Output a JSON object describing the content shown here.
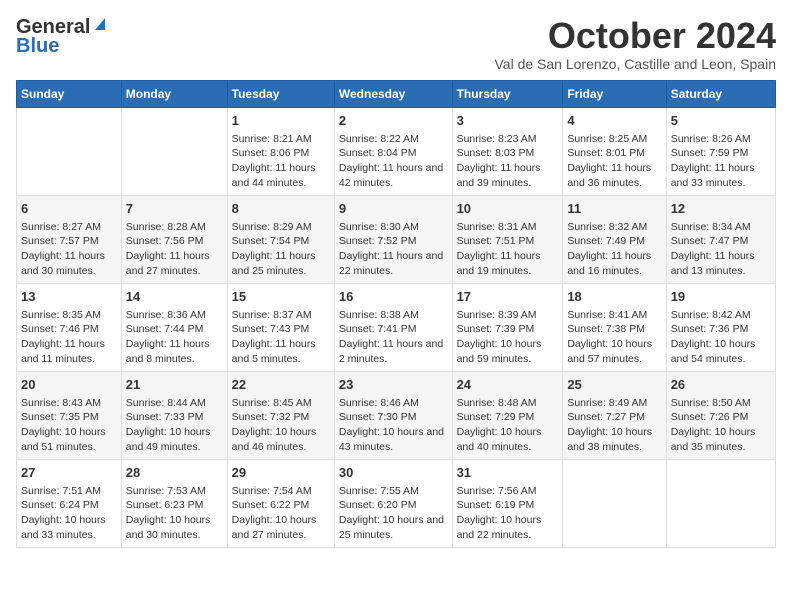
{
  "logo": {
    "line1": "General",
    "line2": "Blue"
  },
  "title": "October 2024",
  "subtitle": "Val de San Lorenzo, Castille and Leon, Spain",
  "weekdays": [
    "Sunday",
    "Monday",
    "Tuesday",
    "Wednesday",
    "Thursday",
    "Friday",
    "Saturday"
  ],
  "weeks": [
    [
      {
        "day": "",
        "info": ""
      },
      {
        "day": "",
        "info": ""
      },
      {
        "day": "1",
        "info": "Sunrise: 8:21 AM\nSunset: 8:06 PM\nDaylight: 11 hours and 44 minutes."
      },
      {
        "day": "2",
        "info": "Sunrise: 8:22 AM\nSunset: 8:04 PM\nDaylight: 11 hours and 42 minutes."
      },
      {
        "day": "3",
        "info": "Sunrise: 8:23 AM\nSunset: 8:03 PM\nDaylight: 11 hours and 39 minutes."
      },
      {
        "day": "4",
        "info": "Sunrise: 8:25 AM\nSunset: 8:01 PM\nDaylight: 11 hours and 36 minutes."
      },
      {
        "day": "5",
        "info": "Sunrise: 8:26 AM\nSunset: 7:59 PM\nDaylight: 11 hours and 33 minutes."
      }
    ],
    [
      {
        "day": "6",
        "info": "Sunrise: 8:27 AM\nSunset: 7:57 PM\nDaylight: 11 hours and 30 minutes."
      },
      {
        "day": "7",
        "info": "Sunrise: 8:28 AM\nSunset: 7:56 PM\nDaylight: 11 hours and 27 minutes."
      },
      {
        "day": "8",
        "info": "Sunrise: 8:29 AM\nSunset: 7:54 PM\nDaylight: 11 hours and 25 minutes."
      },
      {
        "day": "9",
        "info": "Sunrise: 8:30 AM\nSunset: 7:52 PM\nDaylight: 11 hours and 22 minutes."
      },
      {
        "day": "10",
        "info": "Sunrise: 8:31 AM\nSunset: 7:51 PM\nDaylight: 11 hours and 19 minutes."
      },
      {
        "day": "11",
        "info": "Sunrise: 8:32 AM\nSunset: 7:49 PM\nDaylight: 11 hours and 16 minutes."
      },
      {
        "day": "12",
        "info": "Sunrise: 8:34 AM\nSunset: 7:47 PM\nDaylight: 11 hours and 13 minutes."
      }
    ],
    [
      {
        "day": "13",
        "info": "Sunrise: 8:35 AM\nSunset: 7:46 PM\nDaylight: 11 hours and 11 minutes."
      },
      {
        "day": "14",
        "info": "Sunrise: 8:36 AM\nSunset: 7:44 PM\nDaylight: 11 hours and 8 minutes."
      },
      {
        "day": "15",
        "info": "Sunrise: 8:37 AM\nSunset: 7:43 PM\nDaylight: 11 hours and 5 minutes."
      },
      {
        "day": "16",
        "info": "Sunrise: 8:38 AM\nSunset: 7:41 PM\nDaylight: 11 hours and 2 minutes."
      },
      {
        "day": "17",
        "info": "Sunrise: 8:39 AM\nSunset: 7:39 PM\nDaylight: 10 hours and 59 minutes."
      },
      {
        "day": "18",
        "info": "Sunrise: 8:41 AM\nSunset: 7:38 PM\nDaylight: 10 hours and 57 minutes."
      },
      {
        "day": "19",
        "info": "Sunrise: 8:42 AM\nSunset: 7:36 PM\nDaylight: 10 hours and 54 minutes."
      }
    ],
    [
      {
        "day": "20",
        "info": "Sunrise: 8:43 AM\nSunset: 7:35 PM\nDaylight: 10 hours and 51 minutes."
      },
      {
        "day": "21",
        "info": "Sunrise: 8:44 AM\nSunset: 7:33 PM\nDaylight: 10 hours and 49 minutes."
      },
      {
        "day": "22",
        "info": "Sunrise: 8:45 AM\nSunset: 7:32 PM\nDaylight: 10 hours and 46 minutes."
      },
      {
        "day": "23",
        "info": "Sunrise: 8:46 AM\nSunset: 7:30 PM\nDaylight: 10 hours and 43 minutes."
      },
      {
        "day": "24",
        "info": "Sunrise: 8:48 AM\nSunset: 7:29 PM\nDaylight: 10 hours and 40 minutes."
      },
      {
        "day": "25",
        "info": "Sunrise: 8:49 AM\nSunset: 7:27 PM\nDaylight: 10 hours and 38 minutes."
      },
      {
        "day": "26",
        "info": "Sunrise: 8:50 AM\nSunset: 7:26 PM\nDaylight: 10 hours and 35 minutes."
      }
    ],
    [
      {
        "day": "27",
        "info": "Sunrise: 7:51 AM\nSunset: 6:24 PM\nDaylight: 10 hours and 33 minutes."
      },
      {
        "day": "28",
        "info": "Sunrise: 7:53 AM\nSunset: 6:23 PM\nDaylight: 10 hours and 30 minutes."
      },
      {
        "day": "29",
        "info": "Sunrise: 7:54 AM\nSunset: 6:22 PM\nDaylight: 10 hours and 27 minutes."
      },
      {
        "day": "30",
        "info": "Sunrise: 7:55 AM\nSunset: 6:20 PM\nDaylight: 10 hours and 25 minutes."
      },
      {
        "day": "31",
        "info": "Sunrise: 7:56 AM\nSunset: 6:19 PM\nDaylight: 10 hours and 22 minutes."
      },
      {
        "day": "",
        "info": ""
      },
      {
        "day": "",
        "info": ""
      }
    ]
  ]
}
